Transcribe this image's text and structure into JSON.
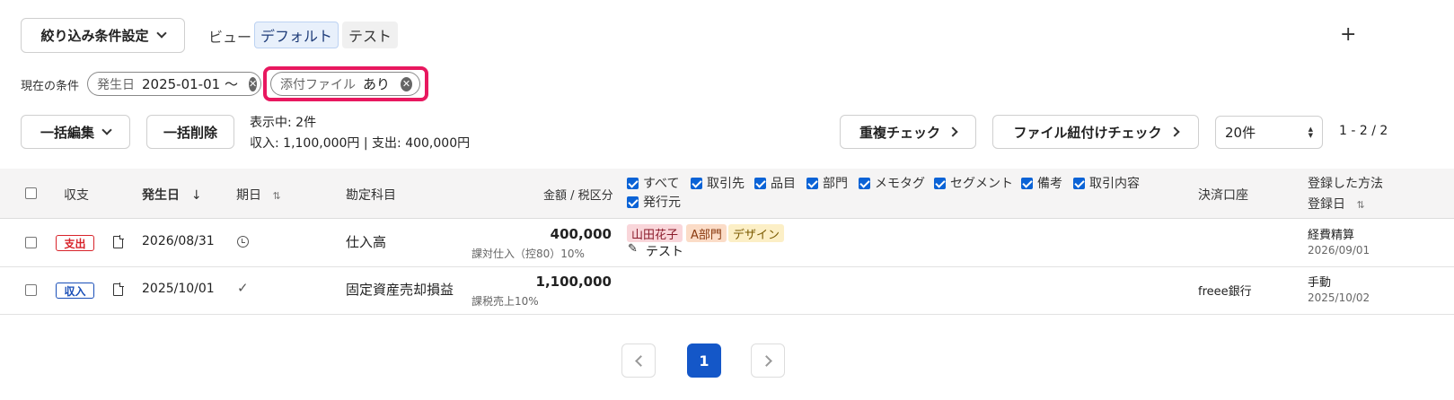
{
  "toolbar": {
    "filter_settings_label": "絞り込み条件設定",
    "view_label": "ビュー",
    "views": [
      "デフォルト",
      "テスト"
    ],
    "add_label": "+"
  },
  "filters": {
    "current_label": "現在の条件",
    "chips": [
      {
        "key": "発生日",
        "value": "2025-01-01 〜"
      },
      {
        "key": "添付ファイル",
        "value": "あり"
      }
    ]
  },
  "actions": {
    "bulk_edit_label": "一括編集",
    "bulk_delete_label": "一括削除",
    "showing_text": "表示中: 2件",
    "totals_text": "収入: 1,100,000円 | 支出: 400,000円",
    "duplicate_check_label": "重複チェック",
    "file_link_check_label": "ファイル紐付けチェック",
    "per_page_value": "20件",
    "range_text": "1 - 2 / 2"
  },
  "table": {
    "headers": {
      "type": "収支",
      "date": "発生日",
      "due": "期日",
      "account": "勘定科目",
      "amount": "金額 / 税区分",
      "payment_account": "決済口座",
      "registered_method": "登録した方法",
      "registered_date": "登録日"
    },
    "column_filters": [
      "すべて",
      "取引先",
      "品目",
      "部門",
      "メモタグ",
      "セグメント",
      "備考",
      "取引内容",
      "発行元"
    ],
    "rows": [
      {
        "type": "支出",
        "date": "2026/08/31",
        "account": "仕入高",
        "amount": "400,000",
        "tax": "課対仕入（控80）10%",
        "tags": [
          "山田花子",
          "A部門",
          "デザイン"
        ],
        "memo": "テスト",
        "payment_account": "",
        "method": "経費精算",
        "registered": "2026/09/01"
      },
      {
        "type": "収入",
        "date": "2025/10/01",
        "account": "固定資産売却損益",
        "amount": "1,100,000",
        "tax": "課税売上10%",
        "tags": [],
        "memo": "",
        "payment_account": "freee銀行",
        "method": "手動",
        "registered": "2025/10/02"
      }
    ]
  },
  "pagination": {
    "current_page": "1"
  },
  "colors": {
    "highlight": "#e8185f",
    "expense": "#d8232a",
    "income": "#1a4fb8",
    "primary": "#1457c8",
    "tag_person": "#f9d6da",
    "tag_dept": "#fbdcc7",
    "tag_item": "#fcefc6"
  },
  "icons": [
    "chevron-down-icon",
    "plus-icon",
    "close-circle-icon",
    "chevron-right-icon",
    "sort-arrow-down-icon",
    "sort-updown-icon",
    "document-icon",
    "clock-icon",
    "check-icon",
    "pencil-icon",
    "chevron-left-icon"
  ]
}
